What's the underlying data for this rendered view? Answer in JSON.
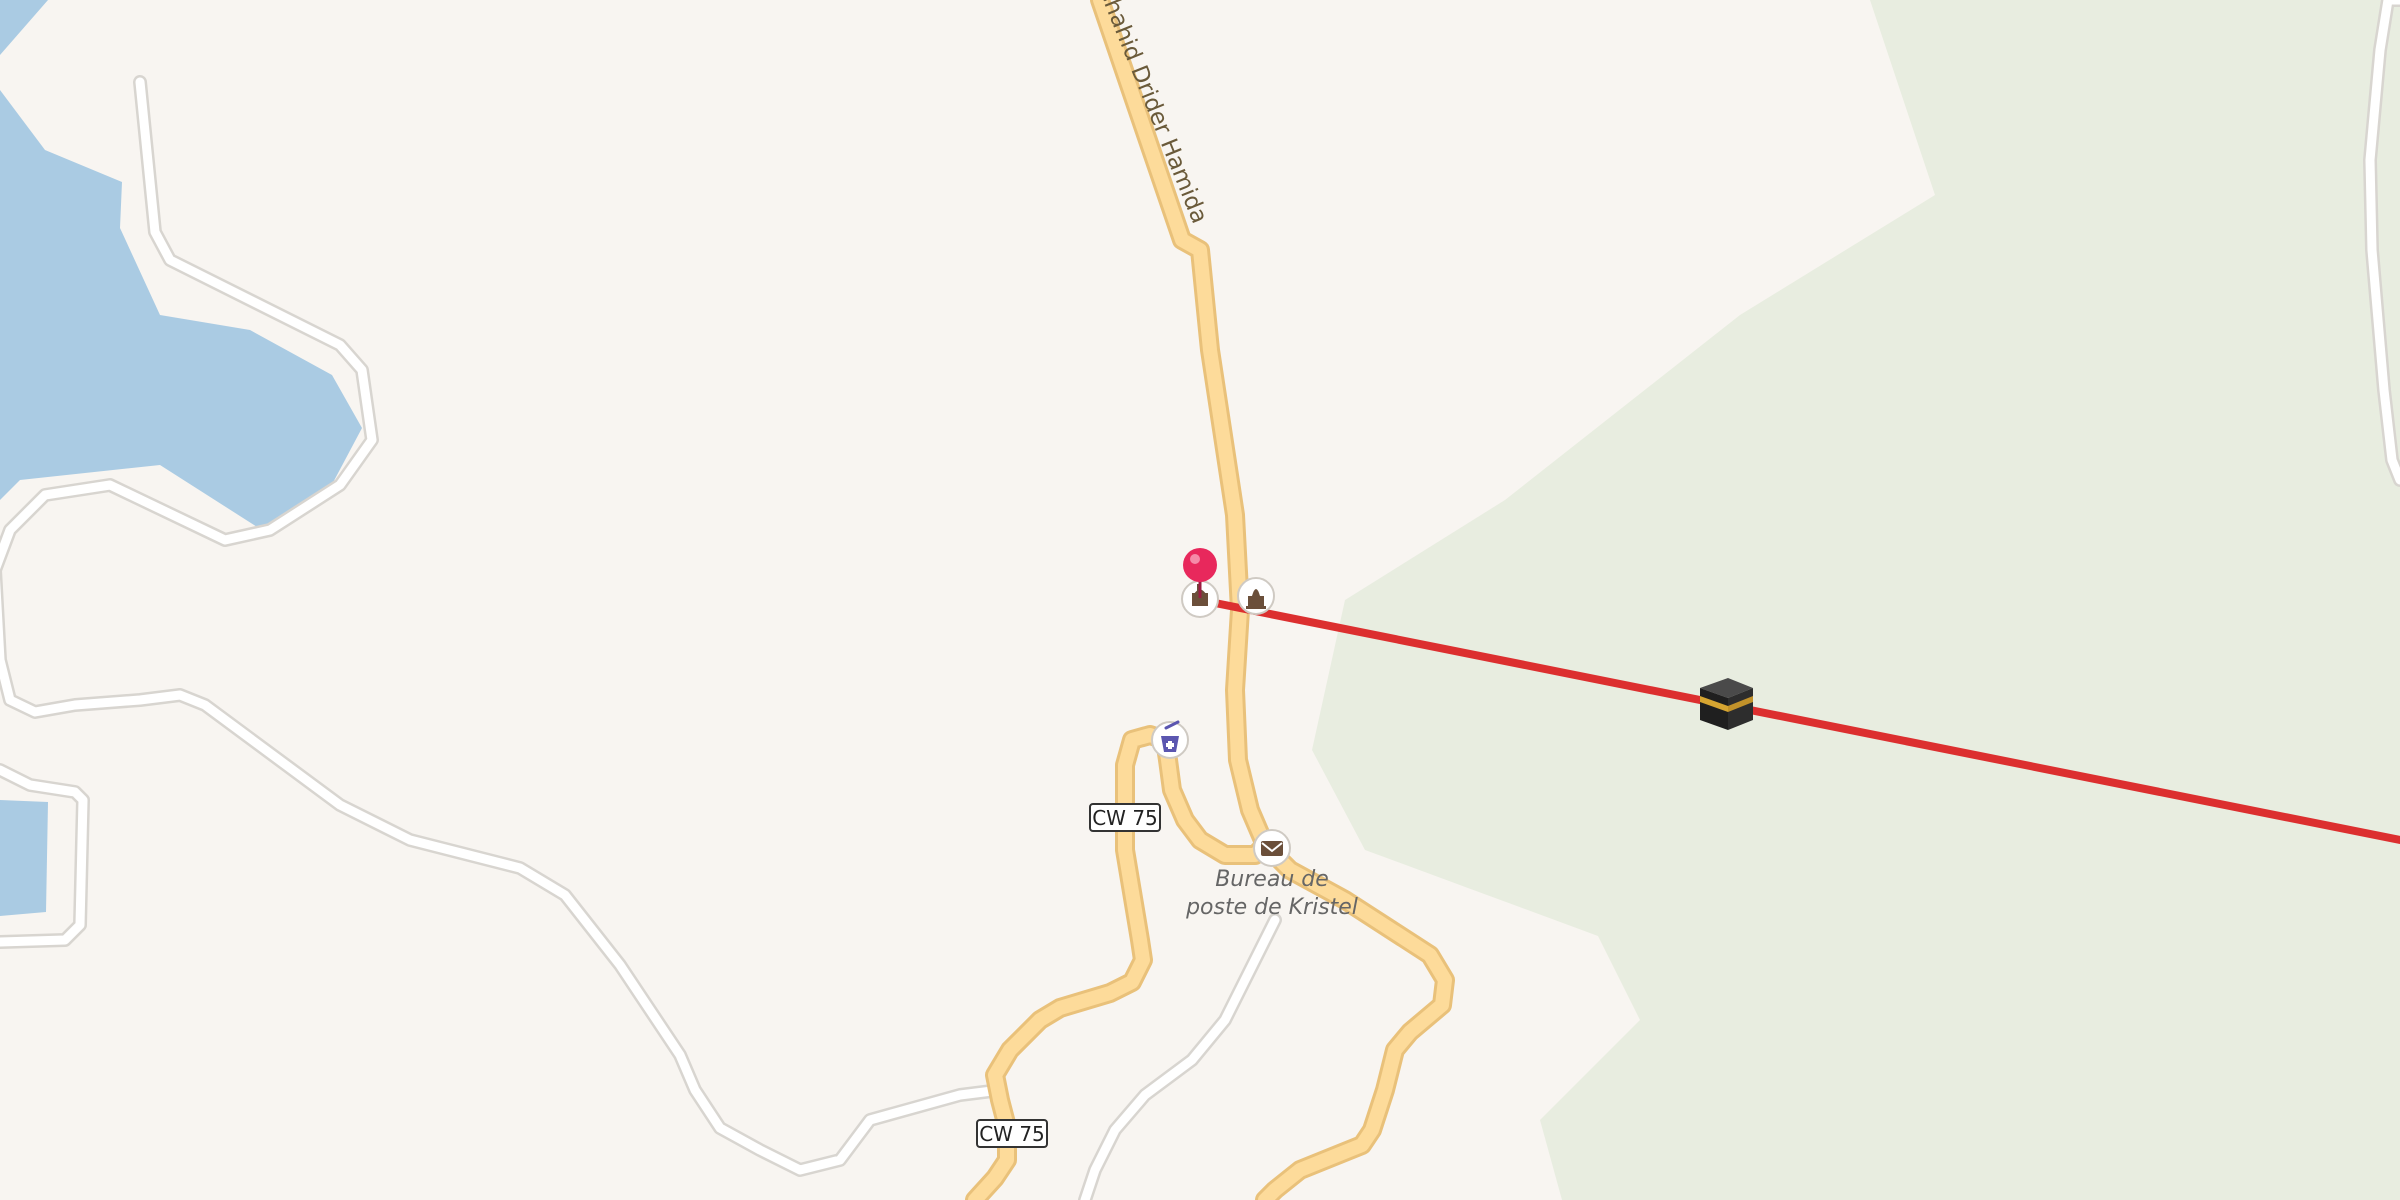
{
  "map": {
    "street_name": "Chahid Drider Hamida",
    "road_refs": [
      "CW 75",
      "CW 75"
    ],
    "poi_labels": {
      "post_office": [
        "Bureau de",
        "poste de Kristel"
      ]
    },
    "markers": {
      "pin": "location-pin-icon",
      "mosque": "mosque-icon",
      "monument": "monument-icon",
      "pharmacy": "pharmacy-icon",
      "post_office": "post-office-icon",
      "kaaba": "kaaba-icon"
    },
    "colors": {
      "land": "#f8f5f1",
      "water": "#aacbe3",
      "park": "#e8ede0",
      "primary_road": "#fddb9a",
      "primary_road_casing": "#e9c17a",
      "minor_road_casing": "#dedbd7",
      "qibla_line": "#dc2f2f",
      "pin": "#e8285c"
    }
  }
}
